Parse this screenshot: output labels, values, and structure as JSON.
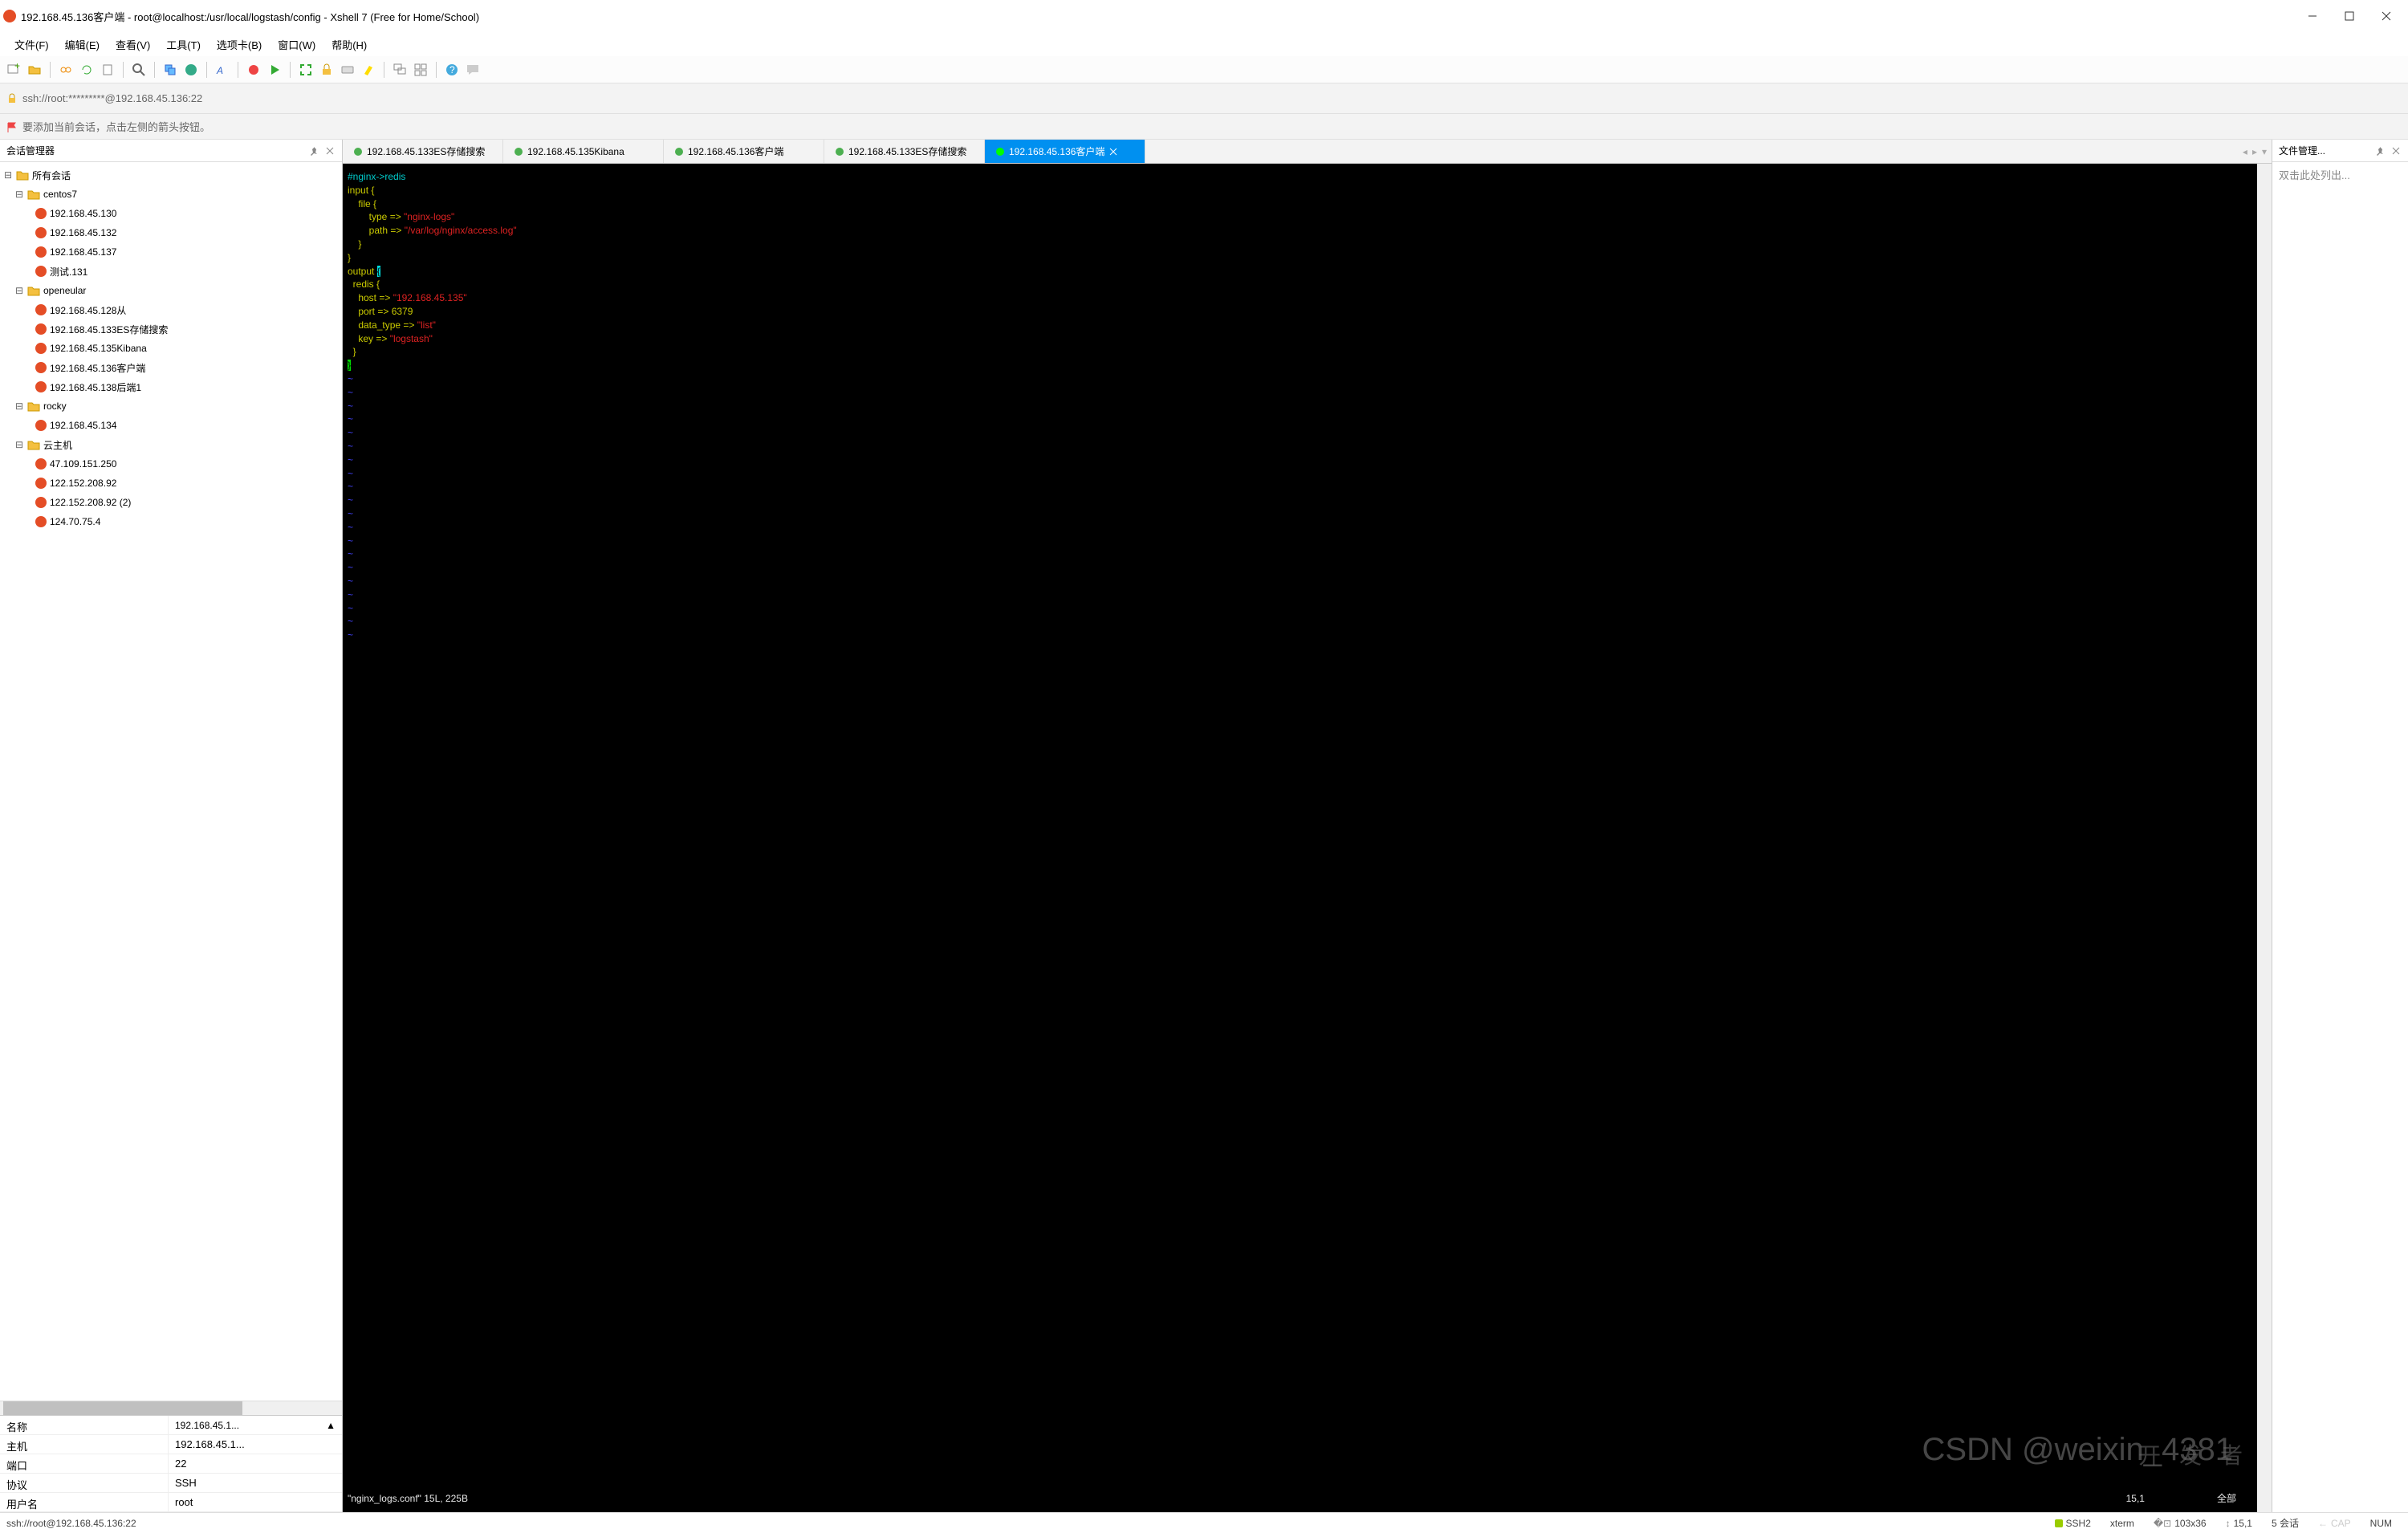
{
  "title": "192.168.45.136客户端 - root@localhost:/usr/local/logstash/config - Xshell 7 (Free for Home/School)",
  "menu": [
    "文件(F)",
    "编辑(E)",
    "查看(V)",
    "工具(T)",
    "选项卡(B)",
    "窗口(W)",
    "帮助(H)"
  ],
  "sshbar": "ssh://root:*********@192.168.45.136:22",
  "hint": "要添加当前会话，点击左侧的箭头按钮。",
  "leftTitle": "会话管理器",
  "tree": {
    "root": "所有会话",
    "g1": "centos7",
    "g1items": [
      "192.168.45.130",
      "192.168.45.132",
      "192.168.45.137",
      "测试.131"
    ],
    "g2": "openeular",
    "g2items": [
      "192.168.45.128从",
      "192.168.45.133ES存储搜索",
      "192.168.45.135Kibana",
      "192.168.45.136客户端",
      "192.168.45.138后端1"
    ],
    "g3": "rocky",
    "g3items": [
      "192.168.45.134"
    ],
    "g4": "云主机",
    "g4items": [
      "47.109.151.250",
      "122.152.208.92",
      "122.152.208.92 (2)",
      "124.70.75.4"
    ]
  },
  "props": [
    {
      "k": "名称",
      "v": "192.168.45.1...",
      "up": "▲"
    },
    {
      "k": "主机",
      "v": "192.168.45.1..."
    },
    {
      "k": "端口",
      "v": "22"
    },
    {
      "k": "协议",
      "v": "SSH"
    },
    {
      "k": "用户名",
      "v": "root"
    }
  ],
  "tabs": [
    {
      "label": "192.168.45.133ES存储搜索",
      "active": false
    },
    {
      "label": "192.168.45.135Kibana",
      "active": false
    },
    {
      "label": "192.168.45.136客户端",
      "active": false
    },
    {
      "label": "192.168.45.133ES存储搜索",
      "active": false
    },
    {
      "label": "192.168.45.136客户端",
      "active": true
    }
  ],
  "code": {
    "l1": "#nginx->redis",
    "l2": "input {",
    "l3": "    file {",
    "l4a": "        type => ",
    "l4b": "\"nginx-logs\"",
    "l5a": "        path => ",
    "l5b": "\"/var/log/nginx/access.log\"",
    "l6": "    }",
    "l7": "}",
    "l8a": "output ",
    "l8b": "{",
    "l9": "  redis {",
    "l10a": "    host => ",
    "l10b": "\"192.168.45.135\"",
    "l11": "    port => 6379",
    "l12a": "    data_type => ",
    "l12b": "\"list\"",
    "l13a": "    key => ",
    "l13b": "\"logstash\"",
    "l14": "  }",
    "l15": "}"
  },
  "termStatus": {
    "file": "\"nginx_logs.conf\" 15L, 225B",
    "pos": "15,1",
    "mode": "全部"
  },
  "rightTitle": "文件管理...",
  "rightHint": "双击此处列出...",
  "status": {
    "host": "ssh://root@192.168.45.136:22",
    "proto": "SSH2",
    "term": "xterm",
    "size": "103x36",
    "cursor": "15,1",
    "sess": "5 会话",
    "cap": "CAP",
    "num": "NUM"
  },
  "watermark": "CSDN @weixin_4381",
  "watermark2": "开 发 者"
}
